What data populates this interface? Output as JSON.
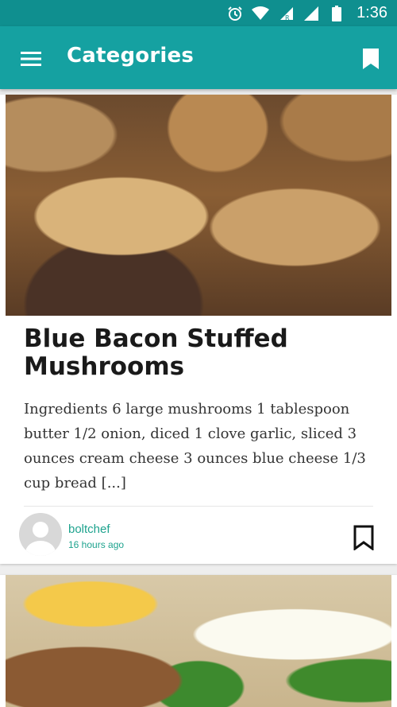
{
  "status_bar": {
    "time": "1:36",
    "icons": [
      "alarm-icon",
      "wifi-icon",
      "signal-roaming-icon",
      "signal-icon",
      "battery-icon"
    ]
  },
  "app_bar": {
    "title": "Categories",
    "menu_icon": "hamburger-menu-icon",
    "bookmark_icon": "bookmark-icon",
    "color": "#15a1a1"
  },
  "posts": [
    {
      "image": "stuffed-mushrooms-photo",
      "title": "Blue Bacon Stuffed Mushrooms",
      "excerpt": "Ingredients 6 large mushrooms 1 tablespoon butter 1/2 onion, diced 1 clove garlic, sliced 3 ounces cream cheese 3 ounces blue cheese 1/3 cup bread [...]",
      "author": "boltchef",
      "time_ago": "16 hours ago",
      "save_icon": "bookmark-outline-icon"
    },
    {
      "image": "crab-cakes-with-dip-photo"
    }
  ],
  "colors": {
    "status_bar": "#0f8f8f",
    "accent_text": "#1ea38e"
  }
}
